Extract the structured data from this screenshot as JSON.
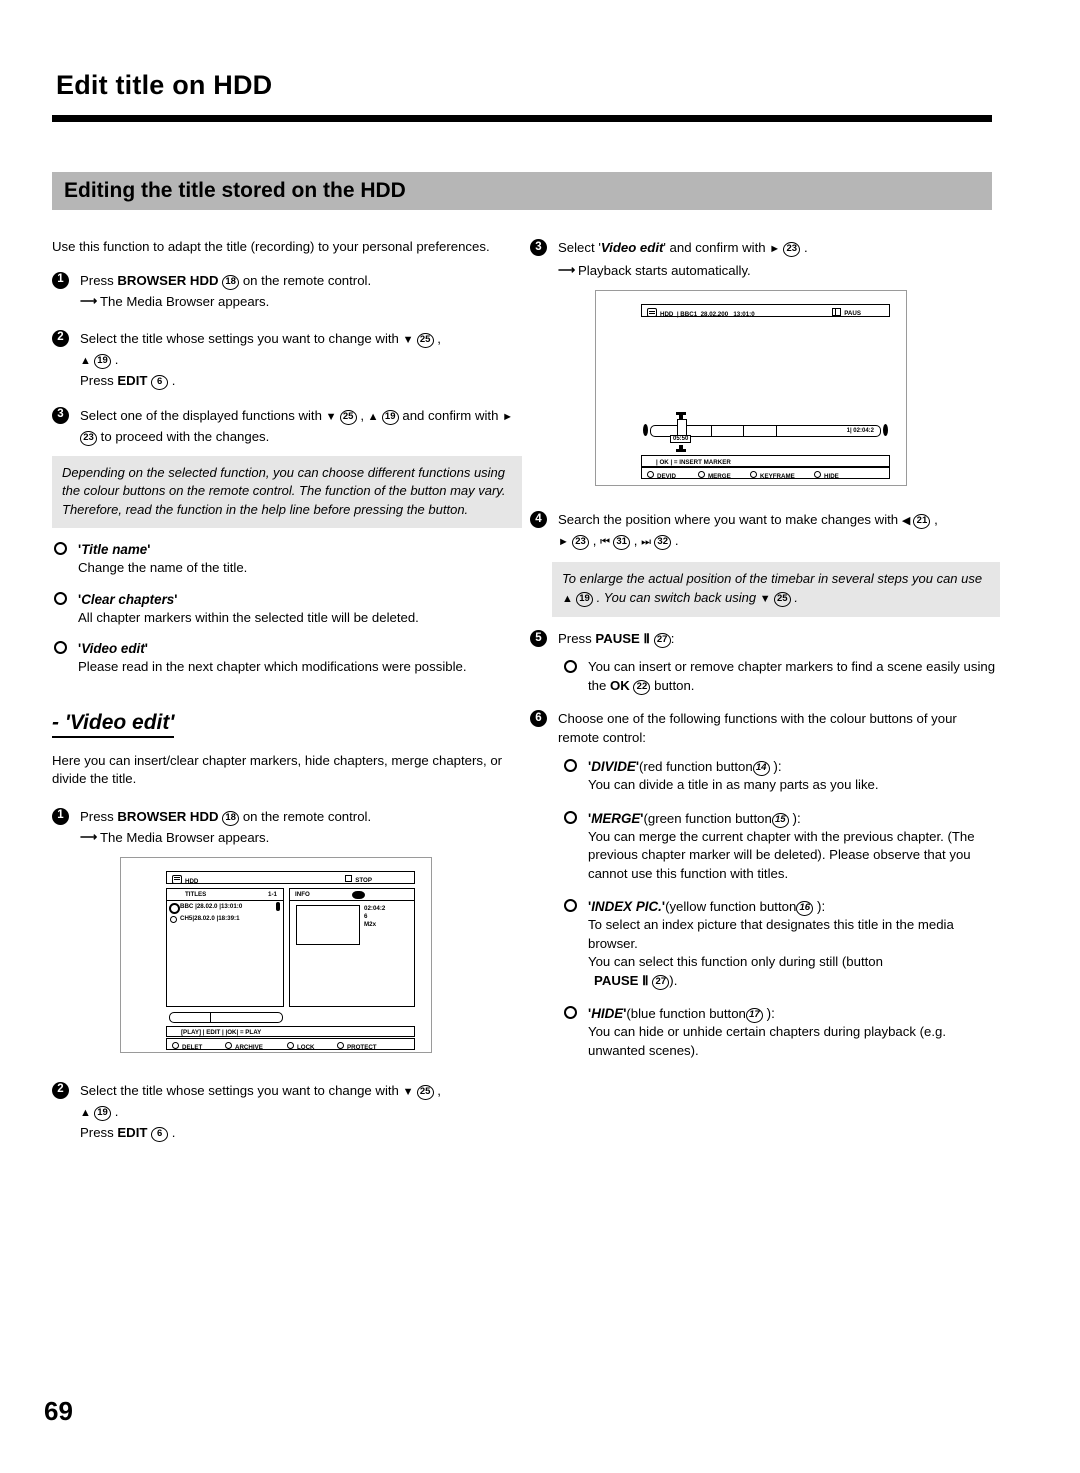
{
  "page": {
    "chapter_title": "Edit title on HDD",
    "section_title": "Editing the title stored on the HDD",
    "page_number": "69"
  },
  "left_column": {
    "intro": "Use this function to adapt the title (recording) to your personal preferences.",
    "steps": [
      {
        "num": "1",
        "text_before": "Press",
        "kbd": "BROWSER HDD",
        "ref": "18",
        "text_after": "on the remote control.",
        "sub": "The Media Browser appears."
      },
      {
        "num": "2",
        "line1": "Select the title whose settings you want to change with",
        "ref1": "25",
        "ref2": "19",
        "press_label": "Press",
        "kbd": "EDIT",
        "ref3": "6"
      },
      {
        "num": "3",
        "line1": "Select one of the displayed functions with",
        "ref1": "25",
        "ref2": "19",
        "line2_a": "and confirm with",
        "ref3": "23",
        "line2_b": "to proceed with the changes."
      }
    ],
    "note": "Depending on the selected function, you can choose different functions using the colour buttons on the remote control. The function of the button may vary. Therefore, read the function in the help line before pressing the button.",
    "bullets": [
      {
        "head": "Title name",
        "desc": "Change the name of the title."
      },
      {
        "head": "Clear chapters",
        "desc": "All chapter markers within the selected title will be deleted."
      },
      {
        "head": "Video edit",
        "desc": "Please read in the next chapter which modifications were possible."
      }
    ],
    "subsection": {
      "heading": "- 'Video edit'",
      "intro": "Here you can insert/clear chapter markers, hide chapters, merge chapters, or divide the title.",
      "steps": [
        {
          "num": "1",
          "text_before": "Press",
          "kbd": "BROWSER HDD",
          "ref": "18",
          "text_after": "on the remote control.",
          "sub": "The Media Browser appears."
        },
        {
          "num": "2",
          "line1": "Select the title whose settings you want to change with",
          "ref1": "25",
          "ref2": "19",
          "press_label": "Press",
          "kbd": "EDIT",
          "ref3": "6"
        }
      ]
    }
  },
  "media_browser_screen": {
    "status_left_icon": "hdd-icon",
    "status_left": "HDD",
    "status_right_icon": "stop-icon",
    "status_right": "STOP",
    "titles_header": "TITLES",
    "titles_count": "1-1",
    "info_header": "INFO",
    "info_icon": "eye-icon",
    "rows": [
      {
        "selected": true,
        "channel": "BBC",
        "date": "28.02.0",
        "time": "13:01:0"
      },
      {
        "selected": false,
        "channel": "CH5",
        "date": "28.02.0",
        "time": "18:39:1"
      }
    ],
    "info_values": [
      "02:04:2",
      "6",
      "M2x"
    ],
    "help_line": "[PLAY] | EDIT | |OK|  = PLAY",
    "colour_buttons": [
      "DELET",
      "ARCHIVE",
      "LOCK",
      "PROTECT"
    ]
  },
  "video_edit_screen": {
    "status_icon": "hdd-icon",
    "status_source": "HDD",
    "status_channel": "BBC1",
    "status_date": "28.02.200",
    "status_time": "13:01:0",
    "status_mode_icon": "pause-icon",
    "status_mode": "PAUS",
    "timebar_position": "05:50",
    "timebar_total": "1| 02:04:2",
    "help_line": "| OK | = INSERT  MARKER",
    "colour_buttons": [
      "DEVID",
      "MERGE",
      "KEYFRAME",
      "HIDE"
    ]
  },
  "right_column": {
    "steps": [
      {
        "num": "3",
        "line1_a": "Select '",
        "emph": "Video edit",
        "line1_b": "' and confirm with",
        "ref": "23",
        "sub": "Playback starts automatically."
      },
      {
        "num": "4",
        "line1": "Search the position where you want to make changes with",
        "ref1": "21",
        "ref2": "23",
        "ref3": "31",
        "ref4": "32"
      },
      {
        "num": "5",
        "text_before": "Press",
        "kbd": "PAUSE Ⅱ",
        "ref": "27",
        "colon": ":"
      },
      {
        "num": "6",
        "line1": "Choose one of the following functions with the colour buttons of your remote control:"
      }
    ],
    "note": "To enlarge the actual position of the timebar in several steps you can use ▲ 19 . You can switch back using ▼ 25 .",
    "note_parts": {
      "a": "To enlarge the actual position of the timebar in several steps you can use",
      "ref1": "19",
      "b": ". You can switch back using",
      "ref2": "25",
      "c": "."
    },
    "pause_bullet": {
      "text_a": "You can insert or remove chapter markers to find a scene easily using the",
      "kbd": "OK",
      "ref": "22",
      "text_b": "button."
    },
    "function_bullets": [
      {
        "name": "DIVIDE",
        "colour_text": "(red function button",
        "ref": "14",
        "desc": "You can divide a title in as many parts as you like."
      },
      {
        "name": "MERGE",
        "colour_text": "(green function button",
        "ref": "15",
        "desc": "You can merge the current chapter with the previous chapter. (The previous chapter marker will be deleted). Please observe that you cannot use this function with titles."
      },
      {
        "name": "INDEX PIC.",
        "colour_text": "(yellow function button",
        "ref": "16",
        "desc": "To select an index picture that designates this title in the media browser.",
        "desc2": "You can select this function only during still (button",
        "kbd": "PAUSE Ⅱ",
        "ref2": "27",
        "desc3": ")."
      },
      {
        "name": "HIDE",
        "colour_text": "(blue function button",
        "ref": "17",
        "desc": "You can hide or unhide certain chapters during playback (e.g. unwanted scenes)."
      }
    ]
  }
}
